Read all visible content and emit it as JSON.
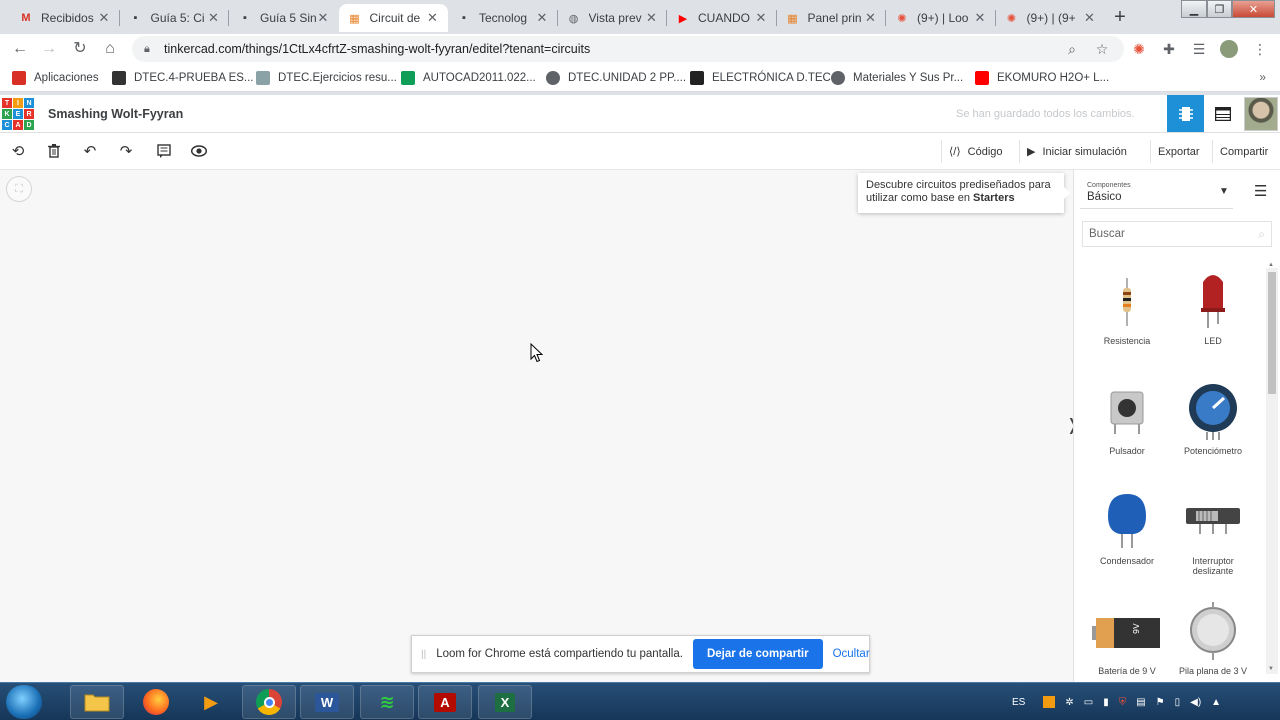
{
  "browser": {
    "tabs": [
      {
        "title": "Recibidos",
        "icon": "gmail-icon",
        "favtext": "M",
        "favcolor": "#d93025",
        "active": false
      },
      {
        "title": "Guía 5: Ci",
        "icon": "classroom-icon",
        "favtext": "▪",
        "favcolor": "#3c4043",
        "active": false
      },
      {
        "title": "Guía 5 Sin",
        "icon": "classroom-icon",
        "favtext": "▪",
        "favcolor": "#3c4043",
        "active": false
      },
      {
        "title": "Circuit de",
        "icon": "tinkercad-icon",
        "favtext": "▦",
        "favcolor": "#e67e22",
        "active": true
      },
      {
        "title": "Tecnolog",
        "icon": "classroom-icon",
        "favtext": "▪",
        "favcolor": "#3c4043",
        "active": false
      },
      {
        "title": "Vista prev",
        "icon": "globe-icon",
        "favtext": "◍",
        "favcolor": "#5f6368",
        "active": false
      },
      {
        "title": "CUANDO",
        "icon": "youtube-icon",
        "favtext": "▶",
        "favcolor": "#ff0000",
        "active": false
      },
      {
        "title": "Panel prin",
        "icon": "tinkercad-icon",
        "favtext": "▦",
        "favcolor": "#e67e22",
        "active": false
      },
      {
        "title": "(9+) | Loo",
        "icon": "loom-icon",
        "favtext": "✺",
        "favcolor": "#e5533c",
        "active": false
      },
      {
        "title": "(9+) | (9+",
        "icon": "loom-icon",
        "favtext": "✺",
        "favcolor": "#e5533c",
        "active": false
      }
    ],
    "url": "tinkercad.com/things/1CtLx4cfrtZ-smashing-wolt-fyyran/editel?tenant=circuits",
    "bookmarks": [
      {
        "label": "Aplicaciones",
        "icon": "apps-grid-icon",
        "color": "#d93025"
      },
      {
        "label": "DTEC.4-PRUEBA ES...",
        "icon": "puzzle-icon",
        "color": "#333333"
      },
      {
        "label": "DTEC.Ejercicios resu...",
        "icon": "image-icon",
        "color": "#8aa1a6"
      },
      {
        "label": "AUTOCAD2011.022...",
        "icon": "sheets-icon",
        "color": "#0f9d58"
      },
      {
        "label": "DTEC.UNIDAD 2 PP....",
        "icon": "globe-icon",
        "color": "#5f6368"
      },
      {
        "label": "ELECTRÓNICA D.TEC",
        "icon": "tec-icon",
        "color": "#222222"
      },
      {
        "label": "Materiales Y Sus Pr...",
        "icon": "globe-icon",
        "color": "#5f6368"
      },
      {
        "label": "EKOMURO H2O+ L...",
        "icon": "youtube-icon",
        "color": "#ff0000"
      }
    ]
  },
  "tinkercad": {
    "logo_letters": [
      "TIN",
      "KER",
      "CAD"
    ],
    "design_title": "Smashing Wolt-Fyyran",
    "save_status": "Se han guardado todos los cambios.",
    "toolbar": {
      "code_label": "Código",
      "simulate_label": "Iniciar simulación",
      "export_label": "Exportar",
      "share_label": "Compartir"
    },
    "starters_tip": {
      "text": "Descubre circuitos prediseñados para utilizar como base en",
      "highlight": "Starters"
    },
    "panel": {
      "category_label": "Componentes",
      "category_value": "Básico",
      "search_placeholder": "Buscar",
      "components": [
        {
          "label": "Resistencia",
          "icon": "resistor-icon"
        },
        {
          "label": "LED",
          "icon": "led-icon"
        },
        {
          "label": "Pulsador",
          "icon": "pushbutton-icon"
        },
        {
          "label": "Potenciómetro",
          "icon": "potentiometer-icon"
        },
        {
          "label": "Condensador",
          "icon": "capacitor-icon"
        },
        {
          "label": "Interruptor deslizante",
          "icon": "slide-switch-icon"
        },
        {
          "label": "Batería de 9 V",
          "icon": "battery-9v-icon"
        },
        {
          "label": "Pila plana de 3 V",
          "icon": "coin-battery-icon"
        }
      ]
    }
  },
  "loom": {
    "message": "Loom for Chrome está compartiendo tu pantalla.",
    "stop_label": "Dejar de compartir",
    "hide_label": "Ocultar"
  },
  "taskbar": {
    "language": "ES"
  },
  "colors": {
    "tinkercad_blue": "#1e90d8",
    "loom_blue": "#1a73e8",
    "led_red": "#b22222"
  }
}
